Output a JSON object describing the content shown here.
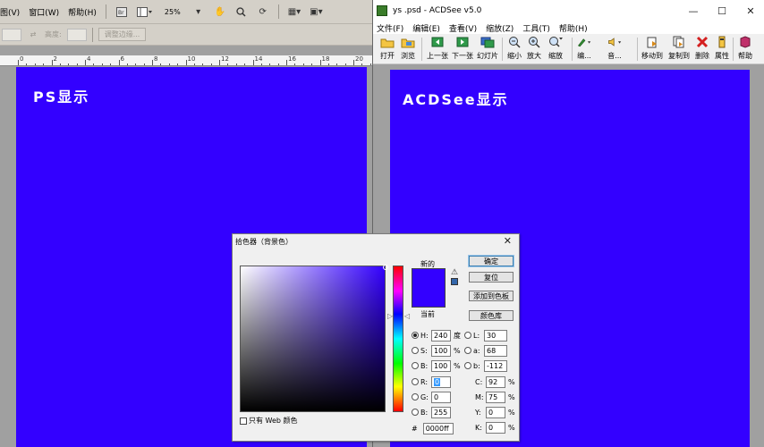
{
  "ps": {
    "menu": [
      "图(V)",
      "窗口(W)",
      "帮助(H)"
    ],
    "menu_icons": [
      "bridge-icon",
      "layout-icon"
    ],
    "zoom": "25%",
    "options": {
      "dim_label": "高度:",
      "adjust_button": "调整边缘..."
    },
    "ruler_ticks": [
      "0",
      "2",
      "4",
      "6",
      "8",
      "10",
      "12",
      "14",
      "16",
      "18",
      "20"
    ],
    "canvas_label": "PS显示",
    "canvas_color": "#3300ff"
  },
  "acdsee": {
    "title": "ys .psd - ACDSee v5.0",
    "window_controls": {
      "minimize": "—",
      "maximize": "☐",
      "close": "✕"
    },
    "menu": [
      "文件(F)",
      "编辑(E)",
      "查看(V)",
      "缩放(Z)",
      "工具(T)",
      "帮助(H)"
    ],
    "toolbar": [
      {
        "label": "打开",
        "icon": "open-folder-icon"
      },
      {
        "label": "浏览",
        "icon": "browse-icon"
      },
      {
        "label": "上一张",
        "icon": "previous-icon"
      },
      {
        "label": "下一张",
        "icon": "next-icon"
      },
      {
        "label": "幻灯片",
        "icon": "slideshow-icon"
      },
      {
        "label": "缩小",
        "icon": "zoom-out-icon"
      },
      {
        "label": "放大",
        "icon": "zoom-in-icon"
      },
      {
        "label": "缩放",
        "icon": "zoom-icon"
      },
      {
        "label": "编...",
        "icon": "edit-icon"
      },
      {
        "label": "音...",
        "icon": "audio-icon"
      },
      {
        "label": "移动到",
        "icon": "move-to-icon"
      },
      {
        "label": "复制到",
        "icon": "copy-to-icon"
      },
      {
        "label": "删除",
        "icon": "delete-icon"
      },
      {
        "label": "属性",
        "icon": "properties-icon"
      },
      {
        "label": "帮助",
        "icon": "help-icon"
      }
    ],
    "canvas_label": "ACDSee显示",
    "canvas_color": "#3300ff"
  },
  "picker": {
    "title": "拾色器（背景色）",
    "close": "✕",
    "new_label": "新的",
    "current_label": "当前",
    "new_color": "#3300ff",
    "buttons": {
      "ok": "确定",
      "reset": "复位",
      "add_swatch": "添加到色板",
      "libraries": "颜色库"
    },
    "web_only_label": "只有 Web 颜色",
    "hsb": {
      "h": "240",
      "s": "100",
      "b": "100"
    },
    "lab": {
      "l": "30",
      "a": "68",
      "b": "-112"
    },
    "rgb": {
      "r": "0",
      "g": "0",
      "b": "255"
    },
    "cmyk": {
      "c": "92",
      "m": "75",
      "y": "0",
      "k": "0"
    },
    "hex": "0000ff",
    "labels": {
      "h": "H:",
      "s": "S:",
      "b": "B:",
      "r": "R:",
      "g": "G:",
      "bb": "B:",
      "l": "L:",
      "a": "a:",
      "lb": "b:",
      "c": "C:",
      "m": "M:",
      "y": "Y:",
      "k": "K:",
      "hash": "#"
    },
    "units": {
      "degree": "度",
      "percent": "%"
    }
  }
}
